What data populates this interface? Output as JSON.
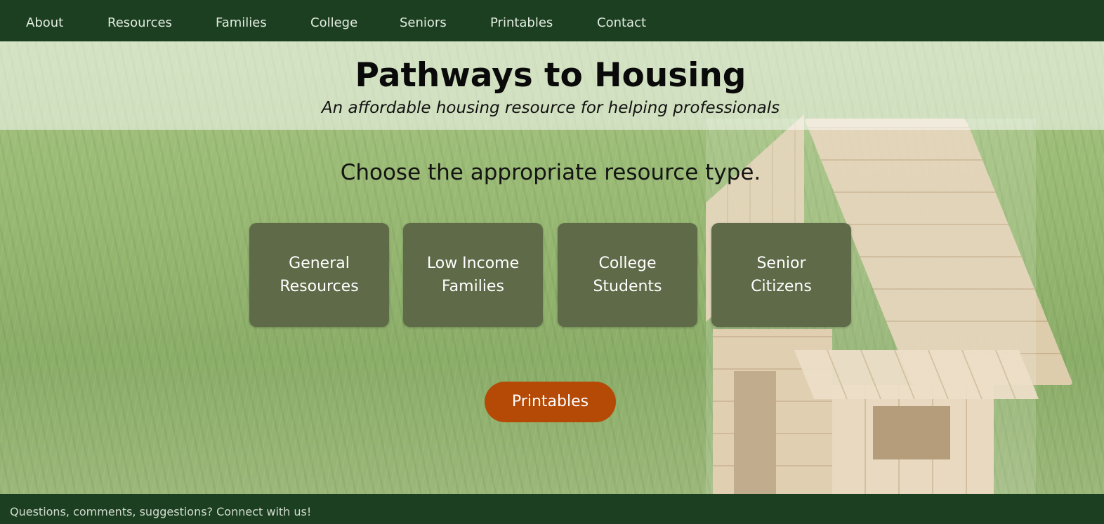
{
  "nav": {
    "items": [
      {
        "label": "About"
      },
      {
        "label": "Resources"
      },
      {
        "label": "Families"
      },
      {
        "label": "College"
      },
      {
        "label": "Seniors"
      },
      {
        "label": "Printables"
      },
      {
        "label": "Contact"
      }
    ]
  },
  "header": {
    "title": "Pathways to Housing",
    "tagline": "An affordable housing resource for helping professionals"
  },
  "main": {
    "prompt": "Choose the appropriate resource type.",
    "tiles": [
      {
        "label": "General Resources"
      },
      {
        "label": "Low Income Families"
      },
      {
        "label": "College Students"
      },
      {
        "label": "Senior Citizens"
      }
    ],
    "printables_button": "Printables"
  },
  "footer": {
    "text": "Questions, comments, suggestions? Connect with us!"
  },
  "colors": {
    "nav_bg": "#1b3f20",
    "tile_bg": "#5f6a48",
    "cta_bg": "#b54a07"
  }
}
